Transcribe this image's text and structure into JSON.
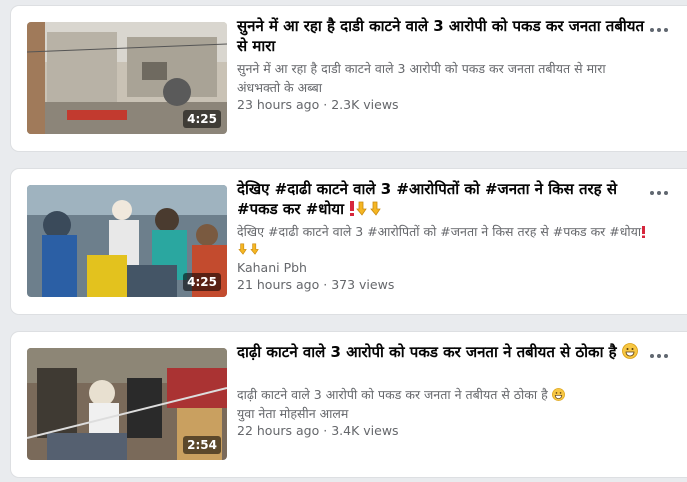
{
  "videos": [
    {
      "title": "सुनने में आ रहा है दाडी काटने वाले 3 आरोपी को पकड कर जनता तबीयत से मारा",
      "description": "सुनने में आ रहा है दाडी काटने वाले 3 आरोपी को पकड कर जनता तबीयत से मारा",
      "channel": "अंधभक्तो के अब्बा",
      "age": "23 hours ago",
      "separator": "·",
      "views": "2.3K views",
      "duration": "4:25",
      "icon": "more-options-icon"
    },
    {
      "title": "देखिए #दाढी काटने वाले 3 #आरोपितों को #जनता ने किस तरह से #पकड कर #धोया",
      "description": "देखिए #दाढी काटने वाले 3 #आरोपितों को #जनता ने किस तरह से #पकड कर #धोया",
      "channel": "Kahani Pbh",
      "age": "21 hours ago",
      "separator": "·",
      "views": "373 views",
      "duration": "4:25",
      "icon": "more-options-icon"
    },
    {
      "title": "दाढ़ी काटने वाले 3 आरोपी को पकड कर जनता ने तबीयत से ठोका है",
      "description": "दाढ़ी काटने वाले 3 आरोपी को पकड कर जनता ने तबीयत से ठोका है",
      "channel": "युवा नेता मोहसीन आलम",
      "age": "22 hours ago",
      "separator": "·",
      "views": "3.4K views",
      "duration": "2:54",
      "icon": "more-options-icon"
    }
  ],
  "colors": {
    "background": "#e9ebee",
    "card": "#ffffff",
    "title": "#050505",
    "secondary": "#65676b"
  }
}
